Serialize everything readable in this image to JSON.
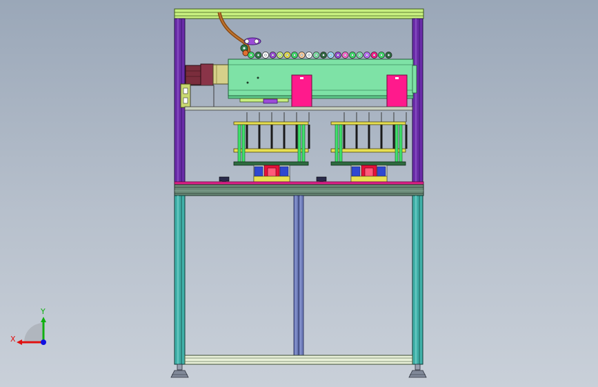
{
  "viewport": {
    "background_top": "#9aa7b8",
    "background_bottom": "#c9d0d9"
  },
  "triad": {
    "x_label": "X",
    "y_label": "Y",
    "x_color": "#e01010",
    "y_color": "#10b010",
    "z_color": "#1010e0"
  },
  "colors": {
    "frame_top_rail": "#c8f080",
    "upright_purple": "#6a2ca8",
    "lower_leg": "#40b0a8",
    "mid_beam": "#6a8a78",
    "magenta_strip": "#e0208a",
    "cylinder_body": "#7ee2a6",
    "pink_block": "#ff1a8c",
    "motor_dark": "#7a2d3c",
    "motor_adapter": "#d6d08a",
    "yellow_plate": "#e8e050",
    "green_post": "#3fe06b",
    "dark_green_base": "#2f6b40",
    "blue_part": "#3048d0",
    "red_block": "#e8103a",
    "mid_post": "#6c7ab8",
    "bottom_rail": "#e8f0d8",
    "foot_gray": "#808898"
  }
}
